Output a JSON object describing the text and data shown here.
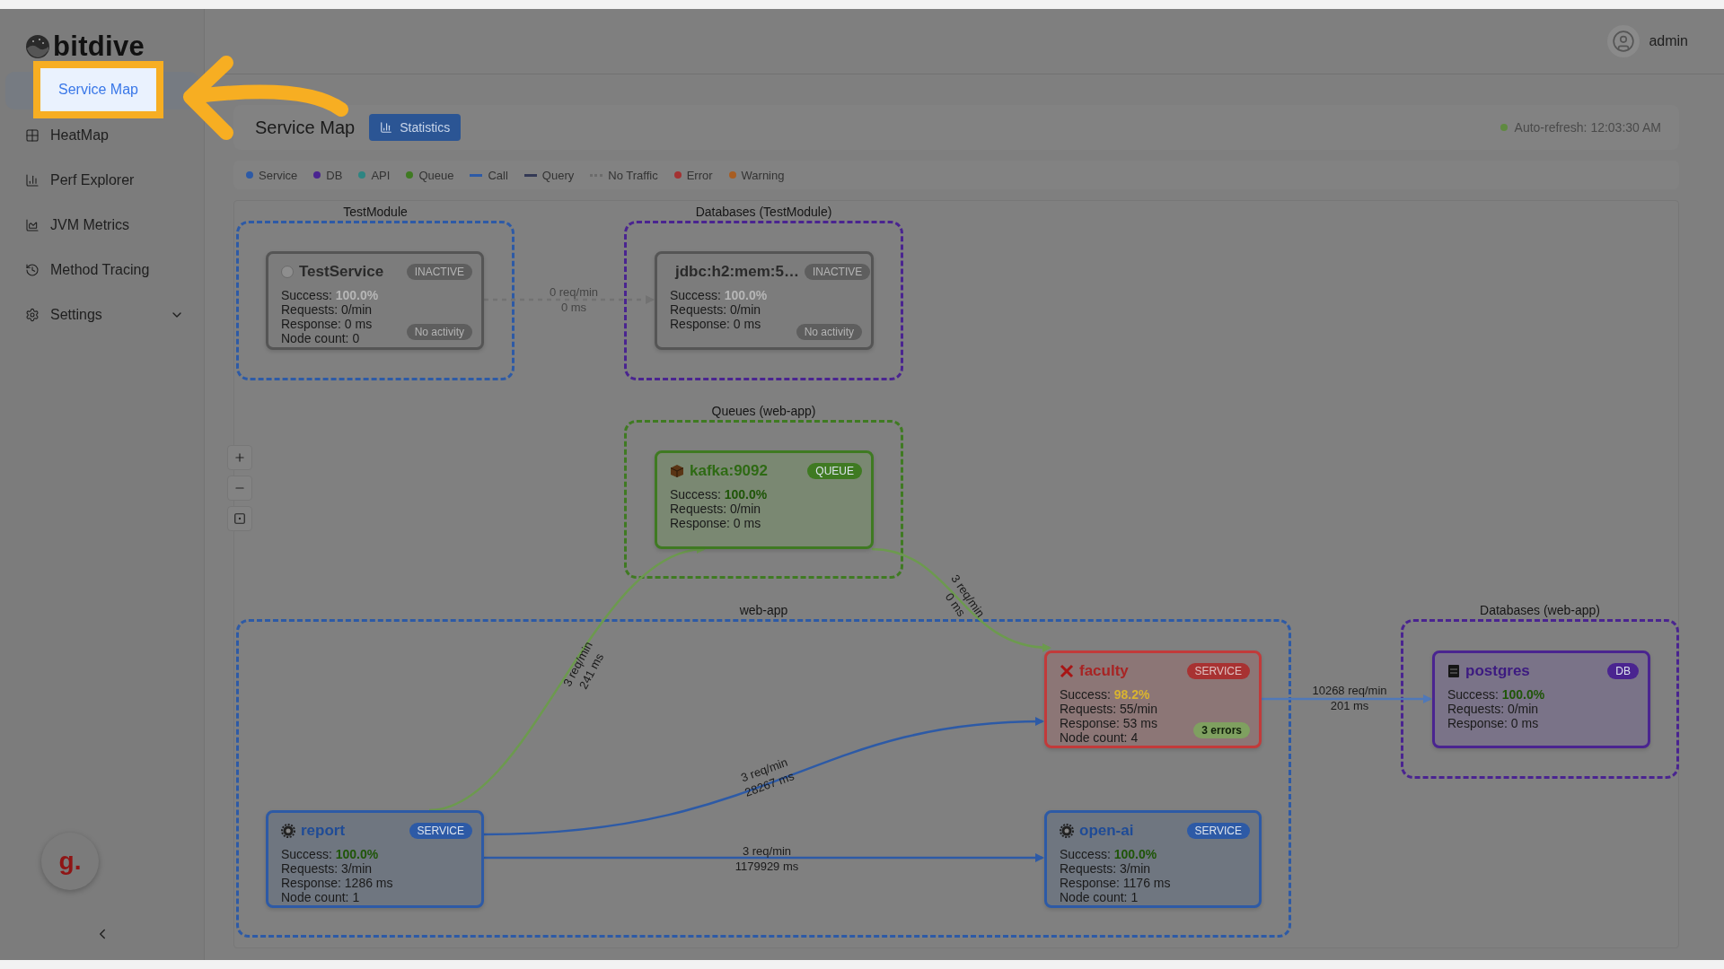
{
  "logo": {
    "text": "bitdive"
  },
  "sidebar": {
    "items": [
      {
        "label": "Service Map",
        "selected": true
      },
      {
        "label": "HeatMap",
        "selected": false
      },
      {
        "label": "Perf Explorer",
        "selected": false
      },
      {
        "label": "JVM Metrics",
        "selected": false
      },
      {
        "label": "Method Tracing",
        "selected": false
      },
      {
        "label": "Settings",
        "selected": false,
        "expanded": false
      }
    ],
    "widget": "g."
  },
  "user": {
    "name": "admin"
  },
  "toolbar": {
    "title": "Service Map",
    "button": "Statistics",
    "auto_refresh": "Auto-refresh: 12:03:30 AM"
  },
  "legend": [
    {
      "label": "Service",
      "kind": "dot",
      "color": "#2d5aa6"
    },
    {
      "label": "DB",
      "kind": "dot",
      "color": "#4a2490"
    },
    {
      "label": "API",
      "kind": "dot",
      "color": "#2e8582"
    },
    {
      "label": "Queue",
      "kind": "dot",
      "color": "#3f7a22"
    },
    {
      "label": "Call",
      "kind": "line",
      "color": "#2d5aa6"
    },
    {
      "label": "Query",
      "kind": "line",
      "color": "#343955"
    },
    {
      "label": "No Traffic",
      "kind": "dotted",
      "color": "#6b6b6b"
    },
    {
      "label": "Error",
      "kind": "dot",
      "color": "#a33232"
    },
    {
      "label": "Warning",
      "kind": "dot",
      "color": "#a85d22"
    }
  ],
  "map": {
    "groups": [
      {
        "label": "TestModule",
        "color": "#2d5aa6"
      },
      {
        "label": "Databases (TestModule)",
        "color": "#4a2490"
      },
      {
        "label": "Queues (web-app)",
        "color": "#3f7a22"
      },
      {
        "label": "web-app",
        "color": "#2d5aa6"
      },
      {
        "label": "Databases (web-app)",
        "color": "#4a2490"
      }
    ],
    "nodes": [
      {
        "name": "TestService",
        "inactive": true,
        "error": false,
        "badge": "INACTIVE",
        "metrics": [
          {
            "label": "Success:",
            "value": "100.0%",
            "warning": false
          },
          {
            "label": "Requests: 0/min"
          },
          {
            "label": "Response: 0 ms"
          },
          {
            "label": "Node count: 0"
          }
        ],
        "footer_badge": "No activity"
      },
      {
        "name": "jdbc:h2:mem:5…",
        "inactive": true,
        "error": false,
        "badge": "INACTIVE",
        "metrics": [
          {
            "label": "Success:",
            "value": "100.0%",
            "warning": false
          },
          {
            "label": "Requests: 0/min"
          },
          {
            "label": "Response: 0 ms"
          }
        ],
        "footer_badge": "No activity"
      },
      {
        "name": "kafka:9092",
        "kind": "queue",
        "inactive": false,
        "error": false,
        "badge": "QUEUE",
        "metrics": [
          {
            "label": "Success:",
            "value": "100.0%",
            "warning": false
          },
          {
            "label": "Requests: 0/min"
          },
          {
            "label": "Response: 0 ms"
          }
        ]
      },
      {
        "name": "faculty",
        "inactive": false,
        "error": true,
        "badge": "SERVICE",
        "metrics": [
          {
            "label": "Success:",
            "value": "98.2%",
            "warning": true
          },
          {
            "label": "Requests: 55/min"
          },
          {
            "label": "Response: 53 ms"
          },
          {
            "label": "Node count: 4"
          }
        ],
        "footer_badge": "3 errors"
      },
      {
        "name": "postgres",
        "kind": "db",
        "inactive": false,
        "error": false,
        "badge": "DB",
        "metrics": [
          {
            "label": "Success:",
            "value": "100.0%",
            "warning": false
          },
          {
            "label": "Requests: 0/min"
          },
          {
            "label": "Response: 0 ms"
          }
        ]
      },
      {
        "name": "report",
        "kind": "service",
        "inactive": false,
        "error": false,
        "badge": "SERVICE",
        "metrics": [
          {
            "label": "Success:",
            "value": "100.0%",
            "warning": false
          },
          {
            "label": "Requests: 3/min"
          },
          {
            "label": "Response: 1286 ms"
          },
          {
            "label": "Node count: 1"
          }
        ]
      },
      {
        "name": "open-ai",
        "kind": "service",
        "inactive": false,
        "error": false,
        "badge": "SERVICE",
        "metrics": [
          {
            "label": "Success:",
            "value": "100.0%",
            "warning": false
          },
          {
            "label": "Requests: 3/min"
          },
          {
            "label": "Response: 1176 ms"
          },
          {
            "label": "Node count: 1"
          }
        ]
      }
    ],
    "edges": [
      {
        "kind": "idle",
        "color": "#727272",
        "rate": "0 req/min",
        "latency": "0 ms"
      },
      {
        "kind": "call",
        "color": "#6c9a4e",
        "rate": "3 req/min",
        "latency": "241 ms"
      },
      {
        "kind": "call",
        "color": "#6c9a4e",
        "rate": "3 req/min",
        "latency": "0 ms"
      },
      {
        "kind": "call",
        "color": "#2d5aa6",
        "rate": "3 req/min",
        "latency": "28267 ms"
      },
      {
        "kind": "call",
        "color": "#2d5aa6",
        "rate": "3 req/min",
        "latency": "1179929 ms"
      },
      {
        "kind": "call",
        "color": "#4f78b8",
        "rate": "10268 req/min",
        "latency": "201 ms"
      }
    ]
  }
}
